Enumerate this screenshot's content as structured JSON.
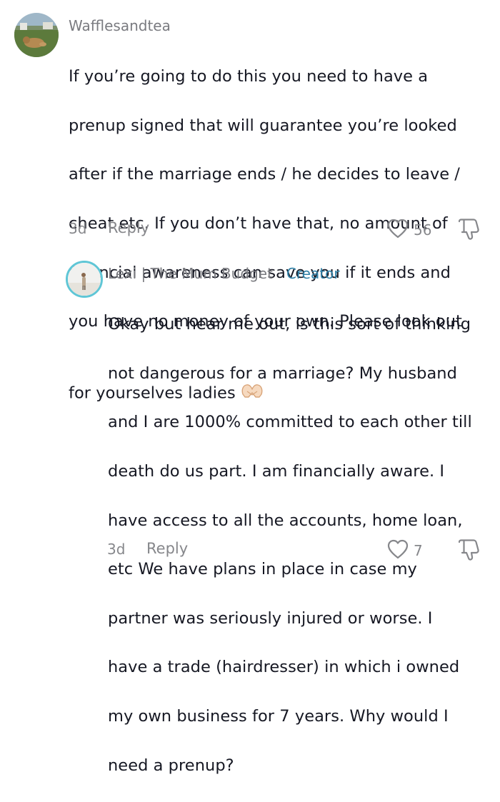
{
  "comments": [
    {
      "username": "Wafflesandtea",
      "lines": [
        "If you’re going to do this you need to have a",
        "prenup signed that will guarantee you’re looked",
        "after if the marriage ends / he decides to leave /",
        "cheat etc. If you don’t have that, no amount of",
        "financial awareness can save you if it ends and",
        "you have no money of your own. Please look out",
        "for yourselves ladies"
      ],
      "emoji": "heart-hands-emoji",
      "time": "3d",
      "reply_label": "Reply",
      "likes": "56"
    },
    {
      "username": "Lexi | The Mum Budget",
      "separator": "·",
      "badge": "Creator",
      "lines": [
        "Okay but hear me out, is this sort of thinking",
        "not dangerous for a marriage? My husband",
        "and I are 1000% committed to each other till",
        "death do us part. I am financially aware. I",
        "have access to all the accounts, home loan,",
        "etc We have plans in place in case my",
        "partner was seriously injured or worse. I",
        "have a trade (hairdresser) in which i owned",
        "my own business for 7 years. Why would I",
        "need a prenup?"
      ],
      "time": "3d",
      "reply_label": "Reply",
      "likes": "7"
    }
  ],
  "colors": {
    "text": "#161823",
    "muted": "#86878b",
    "creator": "#2e7fa6",
    "avatar_ring": "#5fc6d6"
  },
  "icons": [
    "heart-outline-icon",
    "thumbs-down-icon"
  ]
}
